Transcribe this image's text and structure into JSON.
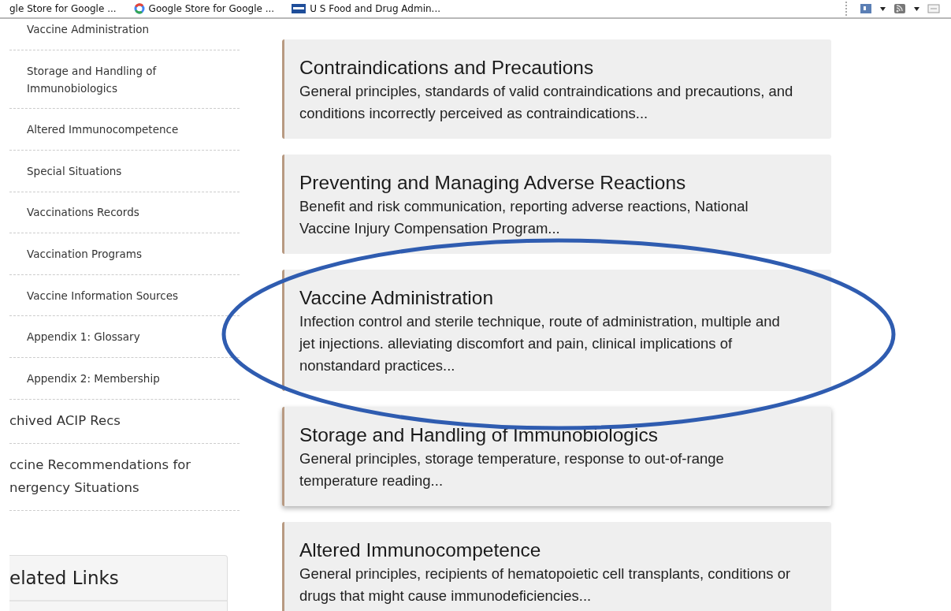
{
  "bookmarks_bar": {
    "bookmarks": [
      {
        "label": "gle Store for Google ..."
      },
      {
        "label": "Google Store for Google ..."
      },
      {
        "label": "U S Food and Drug Admin..."
      }
    ],
    "tools": [
      {
        "kind": "home"
      },
      {
        "kind": "caret"
      },
      {
        "kind": "feed"
      },
      {
        "kind": "caret"
      },
      {
        "kind": "page"
      }
    ]
  },
  "sidebar": {
    "sub_items": [
      {
        "label": "Vaccine Administration"
      },
      {
        "label": "Storage and Handling of Immunobiologics"
      },
      {
        "label": "Altered Immunocompetence"
      },
      {
        "label": "Special Situations"
      },
      {
        "label": "Vaccinations Records"
      },
      {
        "label": "Vaccination Programs"
      },
      {
        "label": "Vaccine Information Sources"
      },
      {
        "label": "Appendix 1: Glossary"
      },
      {
        "label": "Appendix 2: Membership"
      }
    ],
    "items": [
      {
        "label": "chived ACIP Recs"
      },
      {
        "label": "ccine Recommendations for nergency Situations"
      }
    ],
    "related_links": {
      "title": "elated Links"
    }
  },
  "topics": [
    {
      "title": "Contraindications and Precautions",
      "description_lines": [
        "General principles, standards of valid contraindications and precautions, and",
        "conditions incorrectly perceived as contraindications..."
      ],
      "hovered": false
    },
    {
      "title": "Preventing and Managing Adverse Reactions",
      "description_lines": [
        "Benefit and risk communication, reporting adverse reactions, National",
        "Vaccine Injury Compensation Program..."
      ],
      "hovered": false
    },
    {
      "title": "Vaccine Administration",
      "description_lines": [
        "Infection control and sterile technique, route of administration, multiple and",
        "jet injections. alleviating discomfort and pain, clinical implications of",
        "nonstandard practices..."
      ],
      "hovered": false
    },
    {
      "title": "Storage and Handling of Immunobiologics",
      "description_lines": [
        "General principles, storage temperature, response to out-of-range",
        "temperature reading..."
      ],
      "hovered": true
    },
    {
      "title": "Altered Immunocompetence",
      "description_lines": [
        "General principles, recipients of hematopoietic cell transplants, conditions or",
        "drugs that might cause immunodeficiencies..."
      ],
      "hovered": false
    }
  ],
  "annotation": {
    "kind": "ellipse"
  }
}
